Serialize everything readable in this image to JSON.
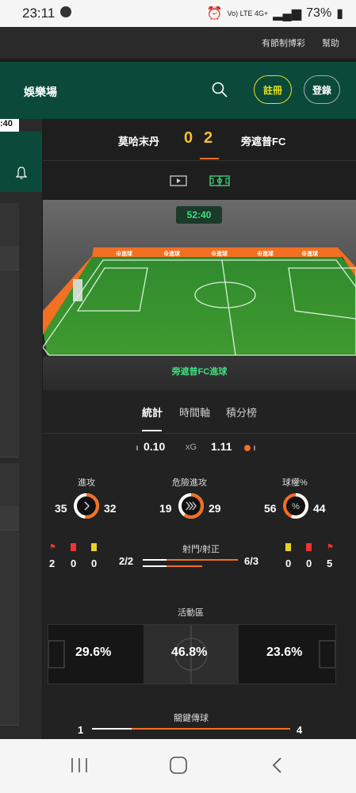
{
  "status": {
    "time": "23:11",
    "battery": "73%",
    "net": "Vo) LTE 4G+"
  },
  "toplinks": {
    "responsible": "有節制博彩",
    "help": "幫助"
  },
  "header": {
    "title": "娛樂場",
    "register": "註冊",
    "login": "登錄"
  },
  "leftpane": {
    "clock": ":40"
  },
  "match": {
    "home": "莫哈末丹",
    "away": "旁遮普FC",
    "home_score": "0",
    "away_score": "2",
    "clock": "52:40",
    "event": "旁遮普FC進球",
    "ad_text": "⊕進球"
  },
  "tabs": {
    "stats": "統計",
    "timeline": "時間軸",
    "standings": "積分榜"
  },
  "xg": {
    "home": "0.10",
    "label": "xG",
    "away": "1.11"
  },
  "stats": [
    {
      "label": "進攻",
      "home": "35",
      "away": "32",
      "icon": "chevron-right-icon",
      "share": 0.48
    },
    {
      "label": "危險進攻",
      "home": "19",
      "away": "29",
      "icon": "double-chevron-icon",
      "share": 0.4
    },
    {
      "label": "球權%",
      "home": "56",
      "away": "44",
      "icon": "percent-icon",
      "share": 0.56
    }
  ],
  "cards": {
    "home": [
      "2",
      "0",
      "0"
    ],
    "away": [
      "0",
      "0",
      "5"
    ]
  },
  "shots": {
    "label": "射門/射正",
    "home": "2/2",
    "away": "6/3"
  },
  "zones": {
    "label": "活動區",
    "home": "29.6%",
    "mid": "46.8%",
    "away": "23.6%"
  },
  "keypass": {
    "label": "關鍵傳球",
    "home": "1",
    "away": "4"
  },
  "colors": {
    "accent": "#f36f21",
    "score": "#f6c12c",
    "brand": "#0b4a3a",
    "goal": "#3fe07f"
  }
}
